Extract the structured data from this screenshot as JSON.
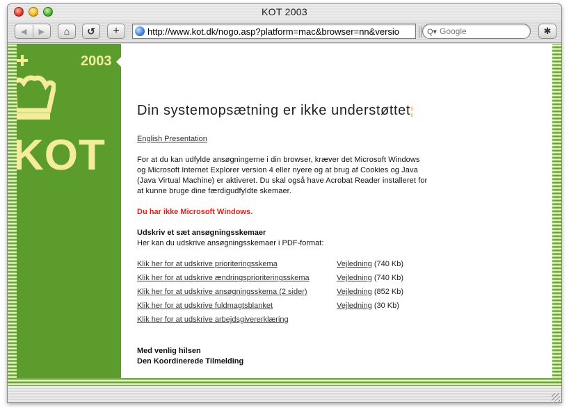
{
  "window": {
    "title": "KOT 2003"
  },
  "toolbar": {
    "back_glyph": "◀",
    "forward_glyph": "▶",
    "home_glyph": "⌂",
    "reload_glyph": "↺",
    "add_glyph": "+",
    "url": "http://www.kot.dk/nogo.asp?platform=mac&browser=nn&versio",
    "search_placeholder": "Google",
    "search_glyph": "Q▾",
    "bug_glyph": "✱"
  },
  "sidebar": {
    "year": "2003",
    "logo_text": "KOT"
  },
  "page": {
    "heading": "Din systemopsætning er ikke understøttet",
    "english_link": "English Presentation",
    "intro": "For at du kan udfylde ansøgningerne i din browser, kræver det Microsoft Windows og Microsoft Internet Explorer version 4 eller nyere og at brug af Cookies og Java (Java Virtual Machine) er aktiveret. Du skal også have Acrobat Reader installeret for at kunne bruge dine færdigudfyldte skemaer.",
    "warning": "Du har ikke Microsoft Windows.",
    "section_title": "Udskriv et sæt ansøgningsskemaer",
    "section_subtitle": "Her kan du udskrive ansøgningsskemaer i PDF-format:",
    "forms": [
      {
        "label": "Klik her for at  udskrive prioriteringsskema",
        "guide": "Vejledning",
        "size": "(740 Kb)"
      },
      {
        "label": "Klik her for at  udskrive ændringsprioriteringsskema",
        "guide": "Vejledning",
        "size": "(740 Kb)"
      },
      {
        "label": "Klik her for at  udskrive ansøgningsskema (2 sider)",
        "guide": "Vejledning",
        "size": "(852 Kb)"
      },
      {
        "label": "Klik her for at  udskrive fuldmagtsblanket",
        "guide": "Vejledning",
        "size": "(30 Kb)"
      },
      {
        "label": "Klik her for at  udskrive arbejdsgivererklæring"
      }
    ],
    "closing_line1": "Med venlig hilsen",
    "closing_line2": "Den Koordinerede Tilmelding"
  },
  "colors": {
    "sidebar_green": "#5b9c2c",
    "logo_yellow": "#f4eb9b",
    "warning_red": "#e0221c"
  }
}
